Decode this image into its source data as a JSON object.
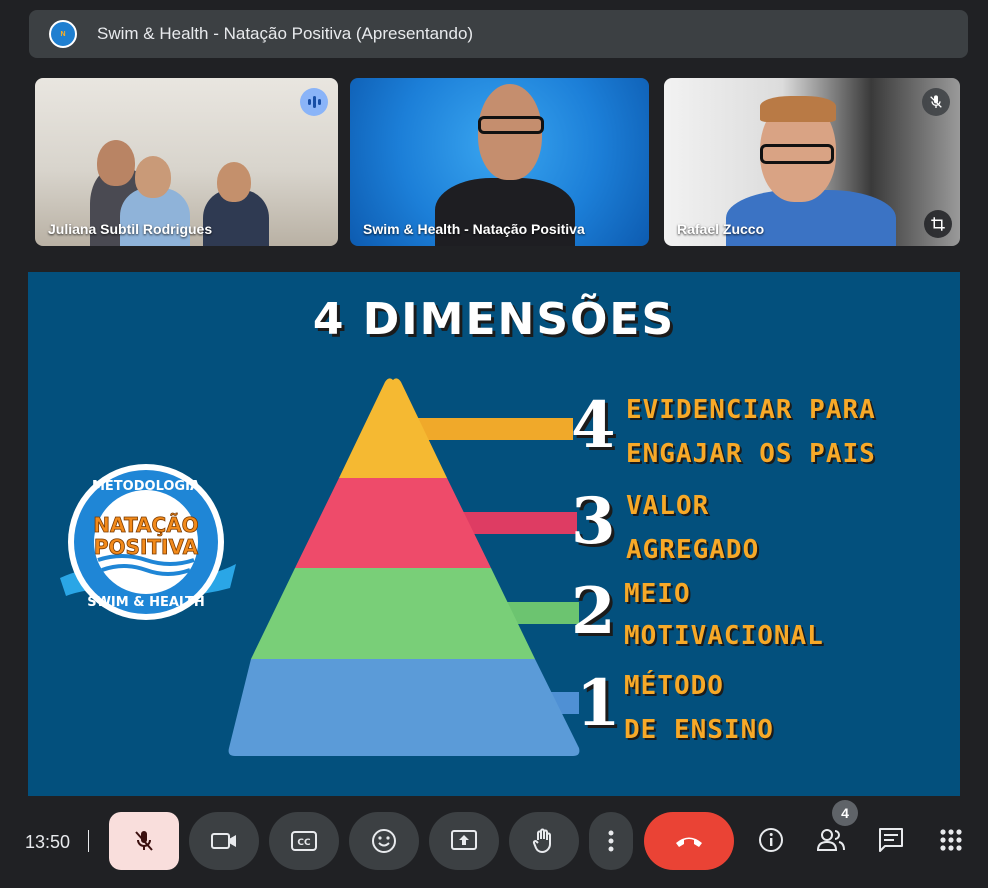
{
  "meeting": {
    "title": "Swim & Health - Natação Positiva (Apresentando)"
  },
  "participants": [
    {
      "name": "Juliana Subtil Rodrigues",
      "status": "speaking"
    },
    {
      "name": "Swim & Health - Natação Positiva",
      "status": "presenting"
    },
    {
      "name": "Rafael Zucco",
      "status": "muted"
    }
  ],
  "slide": {
    "title": "4 DIMENSÕES",
    "logo_text": {
      "top": "METODOLOGIA",
      "middle1": "NATAÇÃO",
      "middle2": "POSITIVA",
      "bottom": "SWIM & HEALTH"
    },
    "levels": [
      {
        "number": "4",
        "line1": "EVIDENCIAR PARA",
        "line2": "ENGAJAR OS PAIS",
        "color": "#f5b932"
      },
      {
        "number": "3",
        "line1": "VALOR",
        "line2": "AGREGADO",
        "color": "#ee4b6a"
      },
      {
        "number": "2",
        "line1": "MEIO",
        "line2": "MOTIVACIONAL",
        "color": "#79cf78"
      },
      {
        "number": "1",
        "line1": "MÉTODO",
        "line2": "DE ENSINO",
        "color": "#5b9bd8"
      }
    ]
  },
  "controls": {
    "clock": "13:50",
    "people_count": "4",
    "icons": [
      "mic-off-icon",
      "camera-icon",
      "captions-icon",
      "emoji-icon",
      "present-icon",
      "raise-hand-icon",
      "more-vert-icon",
      "call-end-icon",
      "info-icon",
      "people-icon",
      "chat-icon",
      "apps-icon"
    ]
  }
}
